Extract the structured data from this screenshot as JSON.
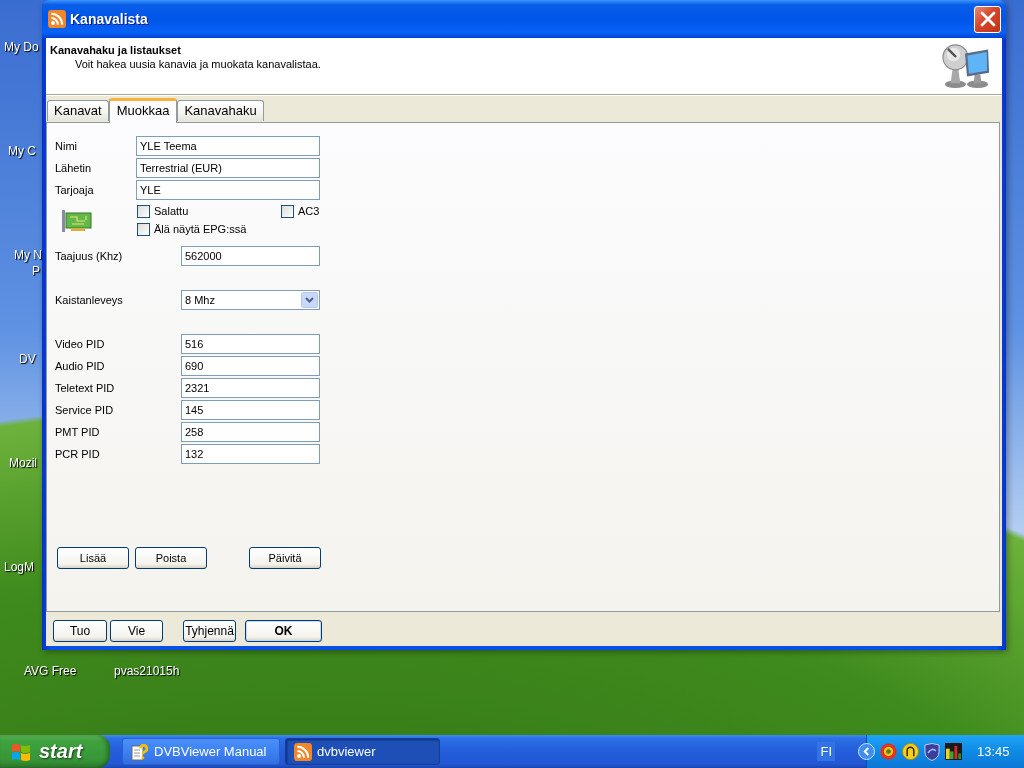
{
  "desktop_icons": [
    {
      "label": "My Do"
    },
    {
      "label": "My C"
    },
    {
      "label": "My N"
    },
    {
      "label": "P"
    },
    {
      "label": "DV"
    },
    {
      "label": "Mozil"
    },
    {
      "label": "LogM"
    },
    {
      "label": "AVG Free"
    },
    {
      "label": "pvas21015h"
    }
  ],
  "window": {
    "title": "Kanavalista",
    "header": {
      "title": "Kanavahaku ja listaukset",
      "subtitle": "Voit hakea uusia kanavia ja muokata kanavalistaa."
    },
    "tabs": [
      {
        "label": "Kanavat",
        "selected": false
      },
      {
        "label": "Muokkaa",
        "selected": true
      },
      {
        "label": "Kanavahaku",
        "selected": false
      }
    ],
    "channel_fields": [
      {
        "label": "Nimi",
        "value": "YLE Teema"
      },
      {
        "label": "Lähetin",
        "value": "Terrestrial (EUR)"
      },
      {
        "label": "Tarjoaja",
        "value": "YLE"
      }
    ],
    "options": [
      {
        "label": "Salattu",
        "checked": false
      },
      {
        "label": "AC3",
        "checked": false
      },
      {
        "label": "Älä näytä EPG:ssä",
        "checked": false
      }
    ],
    "frequency": {
      "label": "Taajuus (Khz)",
      "value": "562000"
    },
    "bandwidth": {
      "label": "Kaistanleveys",
      "value": "8 Mhz"
    },
    "pids": [
      {
        "label": "Video PID",
        "value": "516"
      },
      {
        "label": "Audio PID",
        "value": "690"
      },
      {
        "label": "Teletext PID",
        "value": "2321"
      },
      {
        "label": "Service PID",
        "value": "145"
      },
      {
        "label": "PMT PID",
        "value": "258"
      },
      {
        "label": "PCR PID",
        "value": "132"
      }
    ],
    "panel_buttons": [
      {
        "label": "Lisää"
      },
      {
        "label": "Poista"
      },
      {
        "label": "Päivitä"
      }
    ],
    "footer_buttons": [
      {
        "label": "Tuo",
        "default": false
      },
      {
        "label": "Vie",
        "default": false
      },
      {
        "label": "Tyhjennä",
        "default": false
      },
      {
        "label": "OK",
        "default": true
      }
    ]
  },
  "taskbar": {
    "start": "start",
    "tasks": [
      {
        "label": "DVBViewer Manual",
        "kind": "help",
        "selected": false
      },
      {
        "label": "dvbviewer",
        "kind": "viewer",
        "selected": true
      }
    ],
    "language": "FI",
    "clock": "13:45"
  }
}
